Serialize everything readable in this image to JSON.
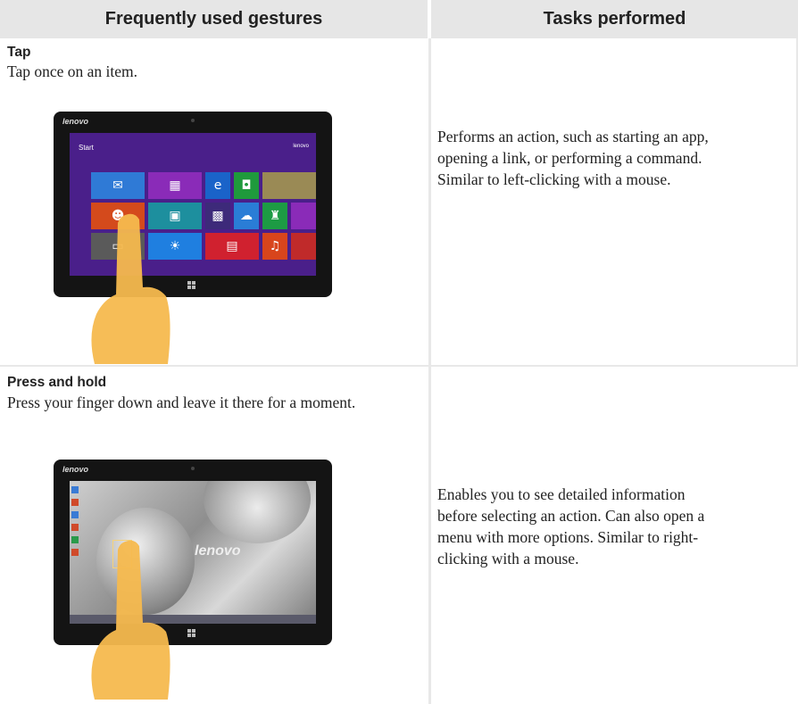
{
  "header": {
    "left": "Frequently used gestures",
    "right": "Tasks performed"
  },
  "rows": [
    {
      "gesture": "Tap",
      "description": "Tap once on an item.",
      "task": "Performs an action, such as starting an app, opening a link, or performing a command. Similar to left-clicking with a mouse.",
      "screen": {
        "brand": "lenovo",
        "start_label": "Start",
        "user_label": "lenovo"
      }
    },
    {
      "gesture": "Press and hold",
      "description": "Press your finger down and leave it there for a moment.",
      "task": "Enables you to see detailed information before selecting an action. Can also open a menu with more options. Similar to right-clicking with a mouse.",
      "screen": {
        "brand": "lenovo",
        "wallpaper_logo": "lenovo"
      }
    }
  ],
  "colors": {
    "header_bg": "#e6e6e6",
    "divider": "#e8e8e8",
    "start_bg": "#4a1f8a",
    "finger": "#f5b94e"
  }
}
